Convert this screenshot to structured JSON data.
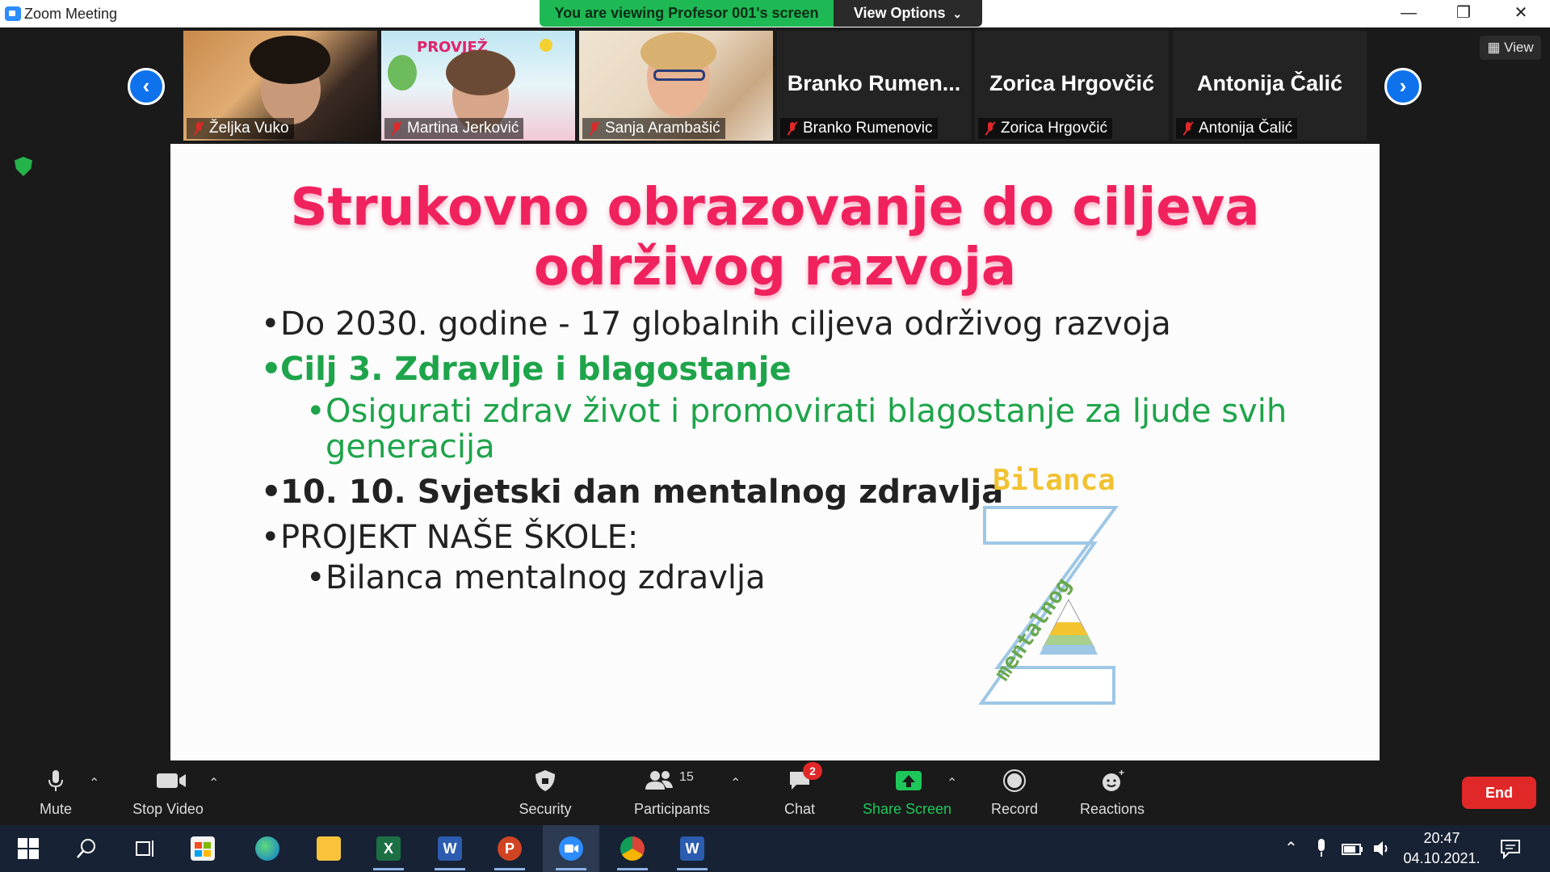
{
  "window": {
    "title": "Zoom Meeting",
    "viewing_banner": "You are viewing Profesor 001's screen",
    "view_options": "View Options",
    "minimize": "—",
    "restore": "❐",
    "close": "✕"
  },
  "gallery": {
    "prev": "‹",
    "next": "›",
    "view_label": "View",
    "participants": [
      {
        "name": "Željka Vuko",
        "video": true
      },
      {
        "name": "Martina Jerković",
        "video": true,
        "overlay_text": "PROVJEŽ"
      },
      {
        "name": "Sanja Arambašić",
        "video": true
      },
      {
        "name": "Branko Rumenovic",
        "display_name": "Branko  Rumen...",
        "video": false
      },
      {
        "name": "Zorica Hrgovčić",
        "display_name": "Zorica Hrgovčić",
        "video": false
      },
      {
        "name": "Antonija Čalić",
        "display_name": "Antonija Čalić",
        "video": false
      }
    ]
  },
  "slide": {
    "title_line1": "Strukovno obrazovanje do ciljeva",
    "title_line2": "održivog razvoja",
    "bullets": [
      {
        "text": "Do 2030. godine - 17 globalnih ciljeva održivog razvoja",
        "level": 1,
        "color": "#222222",
        "bold": false
      },
      {
        "text": "Cilj 3. Zdravlje i blagostanje",
        "level": 1,
        "color": "#1ea44a",
        "bold": true
      },
      {
        "text": "Osigurati zdrav život i promovirati blagostanje za ljude svih",
        "level": 2,
        "color": "#1ea44a",
        "bold": false
      },
      {
        "text": "generacija",
        "level": 2,
        "color": "#1ea44a",
        "bold": false,
        "continuation": true
      },
      {
        "text": "10. 10. Svjetski dan mentalnog zdravlja",
        "level": 1,
        "color": "#222222",
        "bold": true
      },
      {
        "text": "PROJEKT NAŠE ŠKOLE:",
        "level": 1,
        "color": "#222222",
        "bold": false
      },
      {
        "text": "Bilanca mentalnog zdravlja",
        "level": 2,
        "color": "#222222",
        "bold": false
      }
    ],
    "logo_word_top": "Bilanca",
    "logo_word_diagonal": "mentalnog",
    "logo_letter": "Z"
  },
  "toolbar": {
    "mute": "Mute",
    "stop_video": "Stop Video",
    "security": "Security",
    "participants": "Participants",
    "participants_count": "15",
    "chat": "Chat",
    "chat_badge": "2",
    "share_screen": "Share Screen",
    "record": "Record",
    "reactions": "Reactions",
    "end": "End"
  },
  "taskbar": {
    "time": "20:47",
    "date": "04.10.2021.",
    "apps": [
      "start",
      "search",
      "task-view",
      "store",
      "edge",
      "file-explorer",
      "excel",
      "word",
      "powerpoint",
      "zoom",
      "chrome",
      "word"
    ]
  },
  "colors": {
    "accent_blue": "#0e72ed",
    "banner_green": "#1eb954",
    "end_red": "#e02828",
    "slide_title": "#f0225e"
  }
}
